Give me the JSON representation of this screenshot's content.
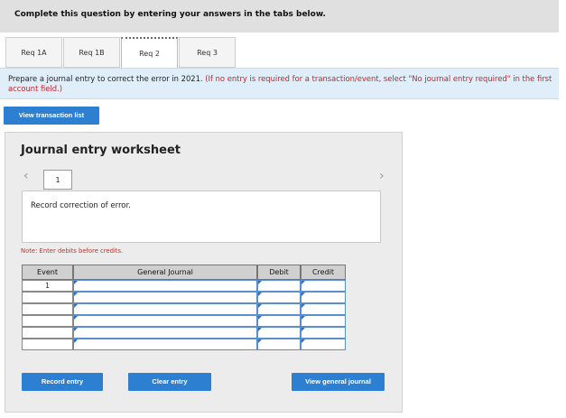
{
  "header": {
    "title": "Complete this question by entering your answers in the tabs below."
  },
  "tabs": [
    {
      "label": "Req 1A",
      "active": false
    },
    {
      "label": "Req 1B",
      "active": false
    },
    {
      "label": "Req 2",
      "active": true
    },
    {
      "label": "Req 3",
      "active": false
    }
  ],
  "prompt": {
    "main": "Prepare a journal entry to correct the error in 2021.",
    "instruction": "(If no entry is required for a transaction/event, select \"No journal entry required\" in the first account field.)"
  },
  "buttons": {
    "view_transaction_list": "View transaction list",
    "record_entry": "Record entry",
    "clear_entry": "Clear entry",
    "view_general_journal": "View general journal"
  },
  "worksheet": {
    "title": "Journal entry worksheet",
    "page_number": "1",
    "description": "Record correction of error.",
    "note": "Note: Enter debits before credits."
  },
  "table": {
    "columns": [
      "Event",
      "General Journal",
      "Debit",
      "Credit"
    ],
    "rows": [
      {
        "event": "1"
      },
      {
        "event": ""
      },
      {
        "event": ""
      },
      {
        "event": ""
      },
      {
        "event": ""
      },
      {
        "event": ""
      }
    ]
  },
  "icons": {
    "prev": "chevron-left-icon",
    "next": "chevron-right-icon"
  },
  "colors": {
    "accent": "#2d7fd1",
    "prompt_bg": "#dfeef8",
    "instruction_red": "#c0262d"
  }
}
